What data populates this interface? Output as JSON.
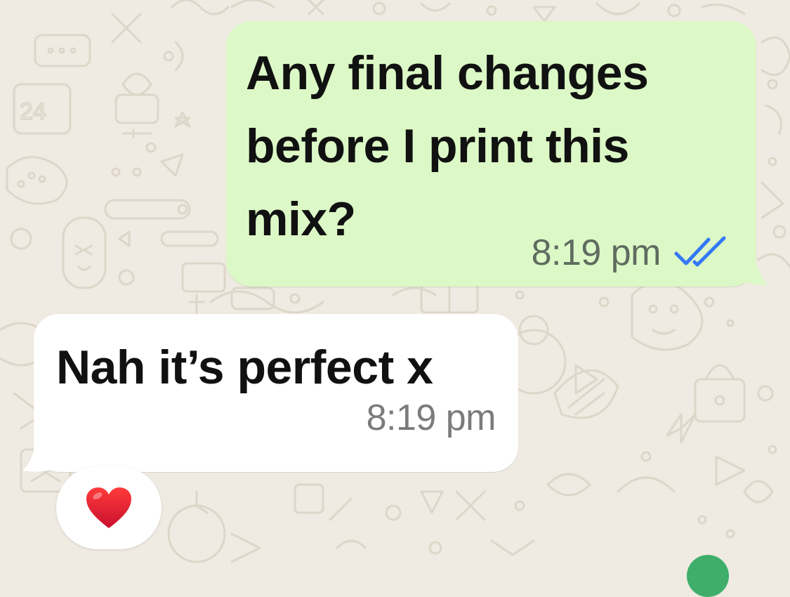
{
  "chat": {
    "messages": [
      {
        "direction": "outgoing",
        "text": "Any final changes\nbefore I print this\nmix?",
        "time": "8:19 pm",
        "status": "read",
        "status_icon": "double-check-icon",
        "status_color": "#3478f6"
      },
      {
        "direction": "incoming",
        "text": "Nah it’s perfect x",
        "time": "8:19 pm",
        "reaction": "❤️"
      }
    ]
  },
  "theme": {
    "wallpaper_color": "#efeae2",
    "outgoing_bubble_color": "#dcf8c6",
    "incoming_bubble_color": "#ffffff",
    "accent_green": "#3fae6b"
  }
}
